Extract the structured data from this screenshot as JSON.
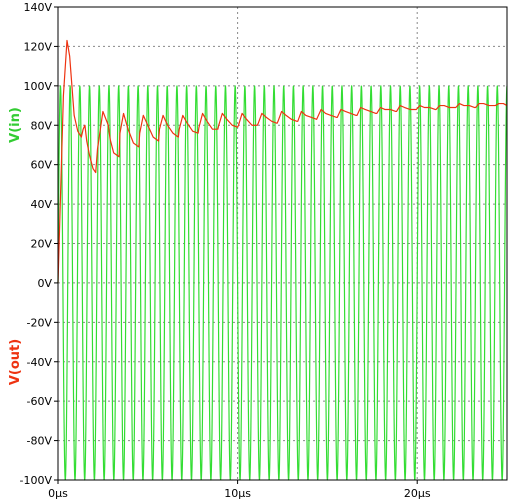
{
  "chart_data": {
    "type": "line",
    "title": "",
    "xlabel": "",
    "axis_labels": {
      "vin": "V(in)",
      "vout": "V(out)"
    },
    "xlim_us": [
      0,
      25
    ],
    "ylim": [
      -100,
      140
    ],
    "grid": true,
    "x_tick_labels": [
      "0µs",
      "10µs",
      "20µs"
    ],
    "x_tick_values_us": [
      0,
      10,
      20
    ],
    "y_tick_labels": [
      "140V",
      "120V",
      "100V",
      "80V",
      "60V",
      "40V",
      "20V",
      "0V",
      "-20V",
      "-40V",
      "-60V",
      "-80V",
      "-100V"
    ],
    "y_tick_values": [
      140,
      120,
      100,
      80,
      60,
      40,
      20,
      0,
      -20,
      -40,
      -60,
      -80,
      -100
    ],
    "series": [
      {
        "name": "V(in)",
        "color": "#33dd33",
        "kind": "sine",
        "amplitude": 100,
        "frequency_mhz": 1.85,
        "offset": 0
      },
      {
        "name": "V(out)",
        "color": "#ee3311",
        "kind": "points",
        "x_us": [
          0,
          0.3,
          0.5,
          0.65,
          0.9,
          1.1,
          1.3,
          1.4,
          1.5,
          1.6,
          1.75,
          1.95,
          2.1,
          2.2,
          2.5,
          2.8,
          2.9,
          3.1,
          3.4,
          3.45,
          3.65,
          3.9,
          4.2,
          4.5,
          4.55,
          4.75,
          5.0,
          5.3,
          5.6,
          5.65,
          5.85,
          6.1,
          6.4,
          6.7,
          6.75,
          6.95,
          7.2,
          7.5,
          7.8,
          7.85,
          8.05,
          8.3,
          8.6,
          8.9,
          8.95,
          9.15,
          9.4,
          9.7,
          10.0,
          10.05,
          10.25,
          10.5,
          10.8,
          11.1,
          11.15,
          11.35,
          11.6,
          11.9,
          12.2,
          12.25,
          12.45,
          12.7,
          13.0,
          13.3,
          13.35,
          13.55,
          13.8,
          14.1,
          14.4,
          14.45,
          14.65,
          14.9,
          15.2,
          15.5,
          15.55,
          15.75,
          16.0,
          16.3,
          16.6,
          16.65,
          16.85,
          17.1,
          17.4,
          17.7,
          17.75,
          17.95,
          18.2,
          18.5,
          18.8,
          18.85,
          19.05,
          19.3,
          19.6,
          19.9,
          19.95,
          20.15,
          20.4,
          20.7,
          21.0,
          21.05,
          21.25,
          21.5,
          21.8,
          22.1,
          22.15,
          22.35,
          22.6,
          22.9,
          23.2,
          23.25,
          23.45,
          23.7,
          24.0,
          24.3,
          24.35,
          24.55,
          24.8,
          25.0
        ],
        "values": [
          0,
          95,
          123,
          115,
          85,
          77,
          74,
          78,
          80,
          72,
          65,
          58,
          56,
          68,
          87,
          80,
          73,
          66,
          64,
          76,
          86,
          78,
          71,
          69,
          76,
          85,
          80,
          74,
          72,
          78,
          85,
          80,
          76,
          74,
          78,
          85,
          81,
          77,
          76,
          79,
          86,
          82,
          78,
          78,
          80,
          86,
          83,
          80,
          79,
          80,
          86,
          83,
          80,
          80,
          81,
          86,
          84,
          82,
          81,
          82,
          87,
          85,
          83,
          82,
          82,
          87,
          85,
          84,
          83,
          84,
          88,
          86,
          85,
          84,
          84,
          88,
          87,
          86,
          85,
          85,
          89,
          88,
          87,
          86,
          86,
          89,
          88,
          88,
          87,
          87,
          90,
          89,
          88,
          88,
          88,
          90,
          89,
          89,
          88,
          88,
          90,
          90,
          89,
          89,
          89,
          91,
          90,
          90,
          89,
          89,
          91,
          91,
          90,
          90,
          90,
          91,
          91,
          90
        ]
      }
    ]
  }
}
